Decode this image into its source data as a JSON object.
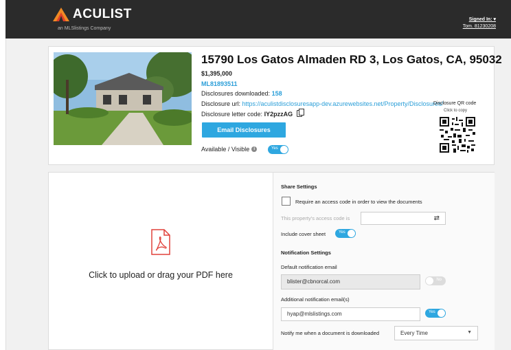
{
  "header": {
    "brand": "ACULIST",
    "tagline": "an MLSlistings Company",
    "signed_in_label": "Signed In: ▾",
    "signed_in_user": "Tom. 81230208"
  },
  "listing": {
    "address": "15790 Los Gatos Almaden RD 3, Los Gatos, CA, 95032",
    "price": "$1,395,000",
    "mls_number": "ML81893511",
    "downloads_label": "Disclosures downloaded:",
    "downloads_count": "158",
    "url_label": "Disclosure url:",
    "url_value": "https://aculistdisclosuresapp-dev.azurewebsites.net/Property/Disclosures/",
    "letter_code_label": "Disclosure letter code:",
    "letter_code_value": "IY2pzzAG",
    "email_button": "Email Disclosures",
    "available_label": "Available / Visible",
    "available_toggle": "Yes",
    "qr_label": "Disclosure QR code",
    "qr_hint": "Click to copy"
  },
  "upload": {
    "text": "Click to upload or drag your PDF here"
  },
  "share": {
    "heading": "Share Settings",
    "require_code_label": "Require an access code in order to view the documents",
    "access_code_placeholder": "This property's access code is",
    "cover_sheet_label": "Include cover sheet",
    "cover_sheet_toggle": "Yes"
  },
  "notifications": {
    "heading": "Notification Settings",
    "default_label": "Default notification email",
    "default_email": "blister@cbnorcal.com",
    "default_toggle": "No",
    "additional_label": "Additional notification email(s)",
    "additional_email": "hyap@mlslistings.com",
    "additional_toggle": "Yes",
    "notify_label": "Notify me when a document is downloaded",
    "notify_value": "Every Time"
  },
  "colors": {
    "accent": "#2ea7e0",
    "header_bg": "#2b2b2b",
    "logo_orange": "#f08a24",
    "logo_red": "#e0402a",
    "pdf_red": "#e0403a"
  }
}
